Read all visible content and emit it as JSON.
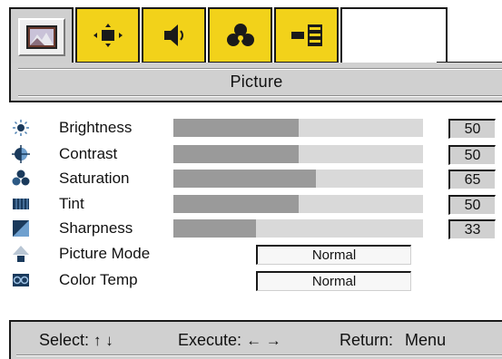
{
  "tabs": [
    {
      "icon": "picture-landscape-icon",
      "active": true
    },
    {
      "icon": "screen-position-icon",
      "active": false
    },
    {
      "icon": "audio-speaker-icon",
      "active": false
    },
    {
      "icon": "color-circles-icon",
      "active": false
    },
    {
      "icon": "tools-blocks-icon",
      "active": false
    },
    {
      "icon": "",
      "active": false
    }
  ],
  "header": {
    "title": "Picture"
  },
  "settings": [
    {
      "label": "Brightness",
      "icon": "brightness-icon",
      "value": "50",
      "level": 0.5
    },
    {
      "label": "Contrast",
      "icon": "contrast-icon",
      "value": "50",
      "level": 0.5
    },
    {
      "label": "Saturation",
      "icon": "saturation-icon",
      "value": "65",
      "level": 0.57
    },
    {
      "label": "Tint",
      "icon": "tint-icon",
      "value": "50",
      "level": 0.5
    },
    {
      "label": "Sharpness",
      "icon": "sharpness-icon",
      "value": "33",
      "level": 0.33
    }
  ],
  "selects": [
    {
      "label": "Picture Mode",
      "icon": "picture-mode-icon",
      "value": "Normal"
    },
    {
      "label": "Color Temp",
      "icon": "color-temp-icon",
      "value": "Normal"
    }
  ],
  "footer": {
    "select_label": "Select:",
    "select_arrows": "↑ ↓",
    "execute_label": "Execute:",
    "execute_arrows": "← →",
    "return_label": "Return:",
    "return_value": "Menu"
  },
  "colors": {
    "tab_yellow": "#f2d21a",
    "panel_gray": "#d0d0d0",
    "bar_fill": "#9a9a9a",
    "bar_track": "#d9d9d9"
  }
}
